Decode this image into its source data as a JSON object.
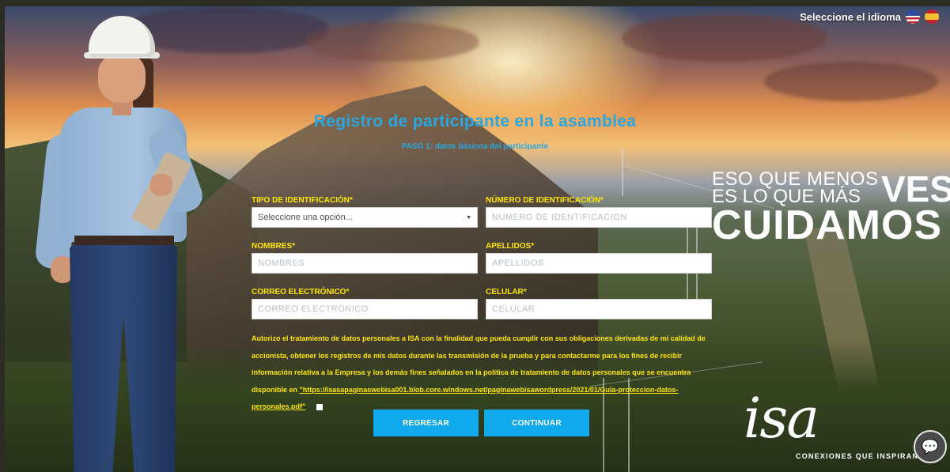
{
  "language": {
    "label": "Seleccione el idioma",
    "flags": [
      "us-flag-icon",
      "es-flag-icon"
    ]
  },
  "header": {
    "title": "Registro de participante en la asamblea",
    "subtitle": "PASO 1: datos básicos del participante"
  },
  "slogan": {
    "line1": "ESO QUE MENOS",
    "line2": "ES LO QUE MÁS",
    "big1": "VES",
    "big2": "CUIDAMOS"
  },
  "form": {
    "tipo_id": {
      "label": "TIPO DE IDENTIFICACIÓN*",
      "value": "Seleccione una opción..."
    },
    "numero_id": {
      "label": "NÚMERO DE IDENTIFICACIÓN*",
      "placeholder": "NÚMERO DE IDENTIFICACIÓN"
    },
    "nombres": {
      "label": "NOMBRES*",
      "placeholder": "NOMBRES"
    },
    "apellidos": {
      "label": "APELLIDOS*",
      "placeholder": "APELLIDOS"
    },
    "correo": {
      "label": "CORREO ELECTRÓNICO*",
      "placeholder": "CORREO ELECTRÓNICO"
    },
    "celular": {
      "label": "CELULAR*",
      "placeholder": "CELULAR"
    },
    "consent": {
      "text": "Autorizo el tratamiento de datos personales a ISA con la finalidad que pueda cumplir con sus obligaciones derivadas de mi calidad de accionista, obtener los registros de mis datos durante las transmisión de la prueba y para contactarme para los fines de recibir información relativa a la Empresa y los demás fines señalados en la política de tratamiento de datos personales que se encuentra disponible en ",
      "link": "\"https://isasapaginaswebisa001.blob.core.windows.net/paginawebisawordpress/2021/01/Guia-proteccion-datos-personales.pdf\""
    },
    "back_label": "REGRESAR",
    "continue_label": "CONTINUAR"
  },
  "brand": {
    "logo": "isa",
    "tagline": "CONEXIONES QUE INSPIRAN"
  },
  "colors": {
    "accent": "#10a9ec",
    "title": "#2aa6e0",
    "labels": "#ffe600"
  }
}
